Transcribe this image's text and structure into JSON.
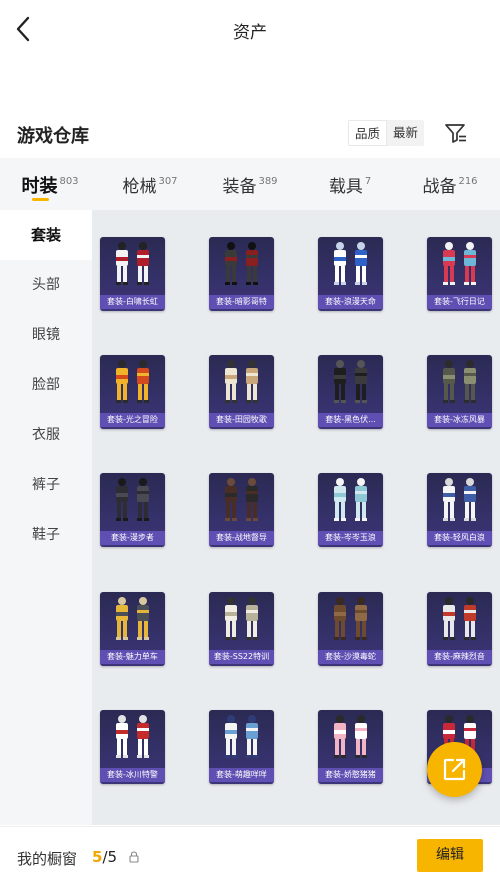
{
  "header": {
    "title": "资产"
  },
  "section": {
    "title": "游戏仓库",
    "sort_options": [
      "品质",
      "最新"
    ],
    "active_sort": 0
  },
  "categories": [
    {
      "label": "时装",
      "count": "803",
      "active": true
    },
    {
      "label": "枪械",
      "count": "307",
      "active": false
    },
    {
      "label": "装备",
      "count": "389",
      "active": false
    },
    {
      "label": "载具",
      "count": "7",
      "active": false
    },
    {
      "label": "战备",
      "count": "216",
      "active": false
    }
  ],
  "sidebar": {
    "items": [
      {
        "label": "套装",
        "active": true
      },
      {
        "label": "头部",
        "active": false
      },
      {
        "label": "眼镜",
        "active": false
      },
      {
        "label": "脸部",
        "active": false
      },
      {
        "label": "衣服",
        "active": false
      },
      {
        "label": "裤子",
        "active": false
      },
      {
        "label": "鞋子",
        "active": false
      }
    ]
  },
  "items": [
    {
      "name": "套装-白啸长虹",
      "palette": [
        "#f3f3f3",
        "#b01e2b",
        "#222"
      ]
    },
    {
      "name": "套装-暗影哥特",
      "palette": [
        "#3a3a3a",
        "#8a1f1f",
        "#111"
      ]
    },
    {
      "name": "套装-浪漫天命",
      "palette": [
        "#ffffff",
        "#2f62c9",
        "#c7d3ea"
      ]
    },
    {
      "name": "套装-飞行日记",
      "palette": [
        "#d83a54",
        "#6fb7d6",
        "#f2f2f2"
      ]
    },
    {
      "name": "套装-光之冒险",
      "palette": [
        "#f0b32a",
        "#d44a1c",
        "#2b2b2b"
      ]
    },
    {
      "name": "套装-田园牧歌",
      "palette": [
        "#ede6d2",
        "#c9a77a",
        "#333"
      ]
    },
    {
      "name": "套装-黑色伏...",
      "palette": [
        "#1e1e1e",
        "#3b3b3b",
        "#555"
      ]
    },
    {
      "name": "套装-冰冻风暴",
      "palette": [
        "#55584a",
        "#8a8f72",
        "#2c2c2c"
      ]
    },
    {
      "name": "套装-漫步者",
      "palette": [
        "#2d2d33",
        "#4a4a55",
        "#1a1a1a"
      ]
    },
    {
      "name": "套装-战地督导",
      "palette": [
        "#4a2e26",
        "#2a2a2a",
        "#6b4a3a"
      ]
    },
    {
      "name": "套装-岑岑玉浪",
      "palette": [
        "#cfe9ef",
        "#8fc9d6",
        "#f5f5f5"
      ]
    },
    {
      "name": "套装-轻风白浪",
      "palette": [
        "#f5f5f5",
        "#3e5fa8",
        "#d9d9d9"
      ]
    },
    {
      "name": "套装-魅力单车",
      "palette": [
        "#e6b63a",
        "#4a4f57",
        "#d9c7a0"
      ]
    },
    {
      "name": "套装-SS22特训",
      "palette": [
        "#f1ede2",
        "#b9b29a",
        "#333"
      ]
    },
    {
      "name": "套装-沙漠毒蛇",
      "palette": [
        "#6e4a2f",
        "#8f6a45",
        "#3a2a1f"
      ]
    },
    {
      "name": "套装-麻辣烈音",
      "palette": [
        "#e8e8e8",
        "#c23a2a",
        "#2a2a2a"
      ]
    },
    {
      "name": "套装-冰川特警",
      "palette": [
        "#ffffff",
        "#c42b2b",
        "#e3e3e3"
      ]
    },
    {
      "name": "套装-萌趣咩咩",
      "palette": [
        "#f4f4f4",
        "#6a9fd3",
        "#2e3c78"
      ]
    },
    {
      "name": "套装-娇憨猪猪",
      "palette": [
        "#f3b4c4",
        "#ffffff",
        "#2a2a2a"
      ]
    },
    {
      "name": "套装-红...",
      "palette": [
        "#c8283a",
        "#ffffff",
        "#2a2a2a"
      ]
    }
  ],
  "showcase": {
    "label": "我的橱窗",
    "current": "5",
    "total": "/5"
  },
  "buttons": {
    "edit": "编辑"
  },
  "icons": {
    "back": "chevron-left-icon",
    "filter": "filter-icon",
    "share": "share-out-icon",
    "lock": "lock-icon"
  },
  "colors": {
    "accent": "#f7b500",
    "tile_bg": "#2f2c5e",
    "caption_bg": "#6e5ac8"
  }
}
